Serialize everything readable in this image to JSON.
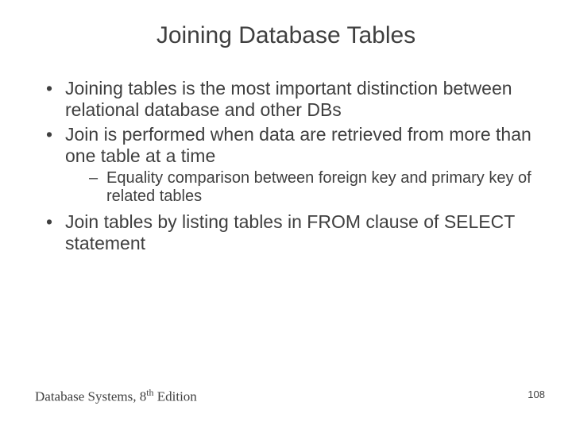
{
  "title": "Joining Database Tables",
  "bullets": {
    "b1": "Joining tables is the most important distinction between relational database and other DBs",
    "b2": "Join is performed when data are retrieved from more than one table at a time",
    "b2_sub1": "Equality comparison between foreign key and primary key of related tables",
    "b3": "Join tables by listing tables in FROM clause of SELECT statement"
  },
  "footer": {
    "book_prefix": "Database Systems, 8",
    "book_sup": "th",
    "book_suffix": " Edition",
    "page": "108"
  }
}
